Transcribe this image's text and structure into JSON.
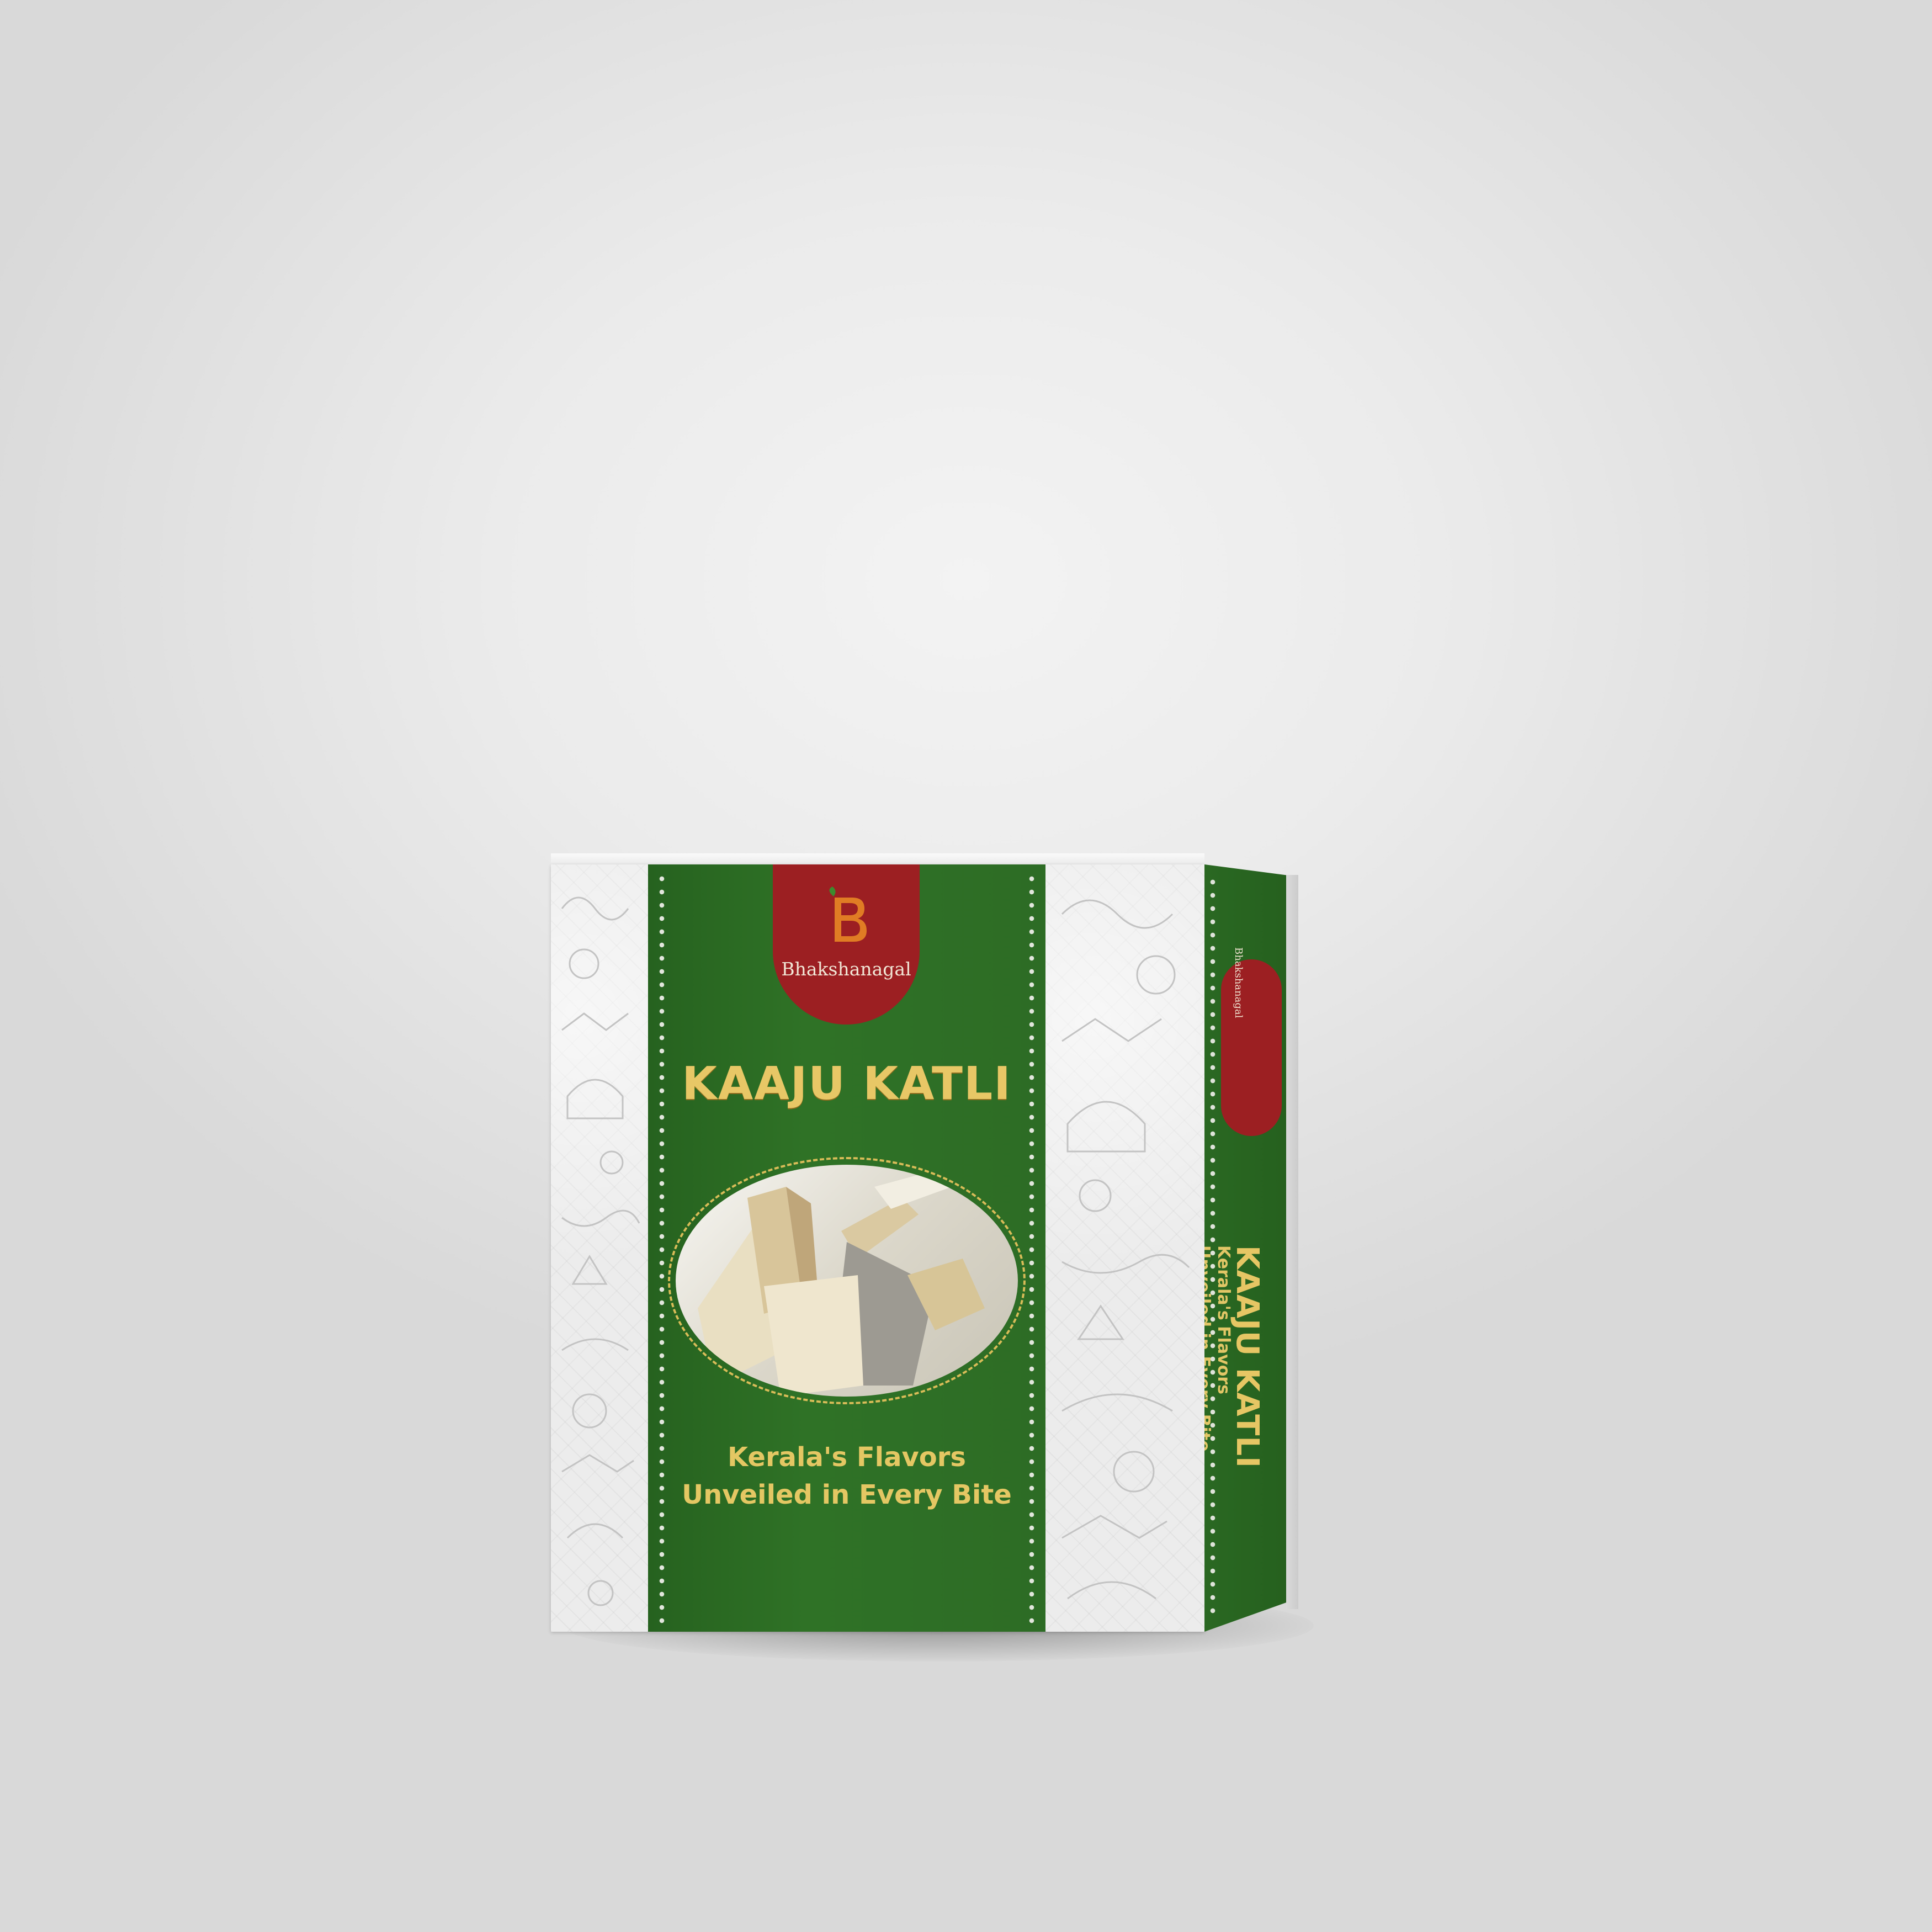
{
  "brand": {
    "logo_letters": "B",
    "name": "Bhakshanagal"
  },
  "product": {
    "title": "KAAJU KATLI",
    "tagline_line1": "Kerala's Flavors",
    "tagline_line2": "Unveiled in Every Bite"
  },
  "side_panel": {
    "brand_name": "Bhakshanagal",
    "title": "KAAJU KATLI",
    "tagline_line1": "Kerala's Flavors",
    "tagline_line2": "Unveiled in Every Bite"
  },
  "colors": {
    "background": "#e8e8e8",
    "band_green": "#2d6c25",
    "badge_red": "#9c1f22",
    "gold_text": "#e8c766"
  },
  "icons": [
    "leaf-icon",
    "sweet-pieces-illustration",
    "kerala-doodle-pattern"
  ]
}
